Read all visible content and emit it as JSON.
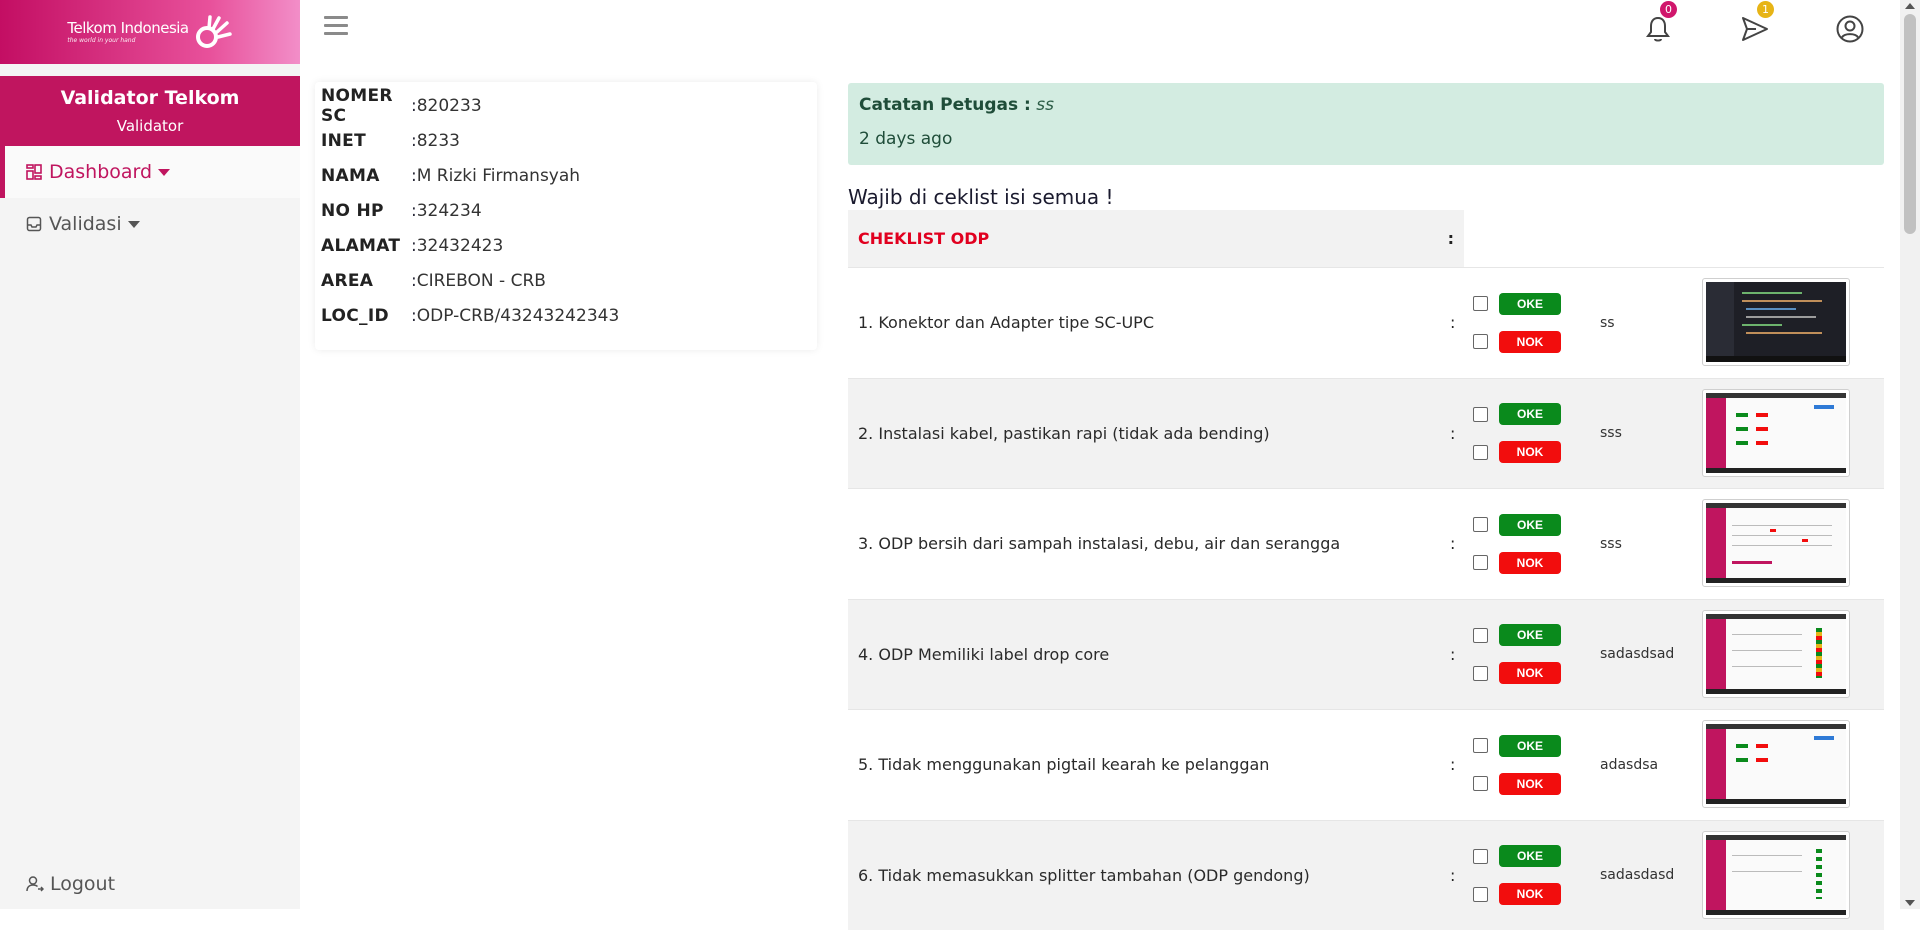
{
  "brand": {
    "name": "Telkom Indonesia",
    "tagline": "the world in your hand",
    "color": "#c0155f"
  },
  "sidebar": {
    "user_name": "Validator Telkom",
    "user_role": "Validator",
    "items": [
      {
        "label": "Dashboard",
        "icon": "dashboard-icon"
      },
      {
        "label": "Validasi",
        "icon": "inbox-icon"
      }
    ],
    "logout": "Logout"
  },
  "topbar": {
    "notif_count": "0",
    "message_count": "1"
  },
  "info": {
    "rows": [
      {
        "label": "NOMER SC",
        "sep": ":",
        "value": "820233"
      },
      {
        "label": "INET",
        "sep": ":",
        "value": "8233"
      },
      {
        "label": "NAMA",
        "sep": ":",
        "value": "M Rizki Firmansyah"
      },
      {
        "label": "NO HP",
        "sep": ":",
        "value": "324234"
      },
      {
        "label": "ALAMAT",
        "sep": ":",
        "value": "32432423"
      },
      {
        "label": "AREA",
        "sep": ":",
        "value": "CIREBON - CRB"
      },
      {
        "label": "LOC_ID",
        "sep": ":",
        "value": "ODP-CRB/43243242343"
      }
    ]
  },
  "note": {
    "label": "Catatan Petugas :",
    "text": "ss",
    "time": "2 days ago"
  },
  "warning": "Wajib di ceklist isi semua !",
  "checklist": {
    "title": "CHEKLIST ODP",
    "colon": ":",
    "ok_label": "OKE",
    "nok_label": "NOK",
    "items": [
      {
        "label": "1. Konektor dan Adapter tipe SC-UPC",
        "note": "ss"
      },
      {
        "label": "2. Instalasi kabel, pastikan rapi (tidak ada bending)",
        "note": "sss"
      },
      {
        "label": "3. ODP bersih dari sampah instalasi, debu, air dan serangga",
        "note": "sss"
      },
      {
        "label": "4. ODP Memiliki label drop core",
        "note": "sadasdsad"
      },
      {
        "label": "5. Tidak menggunakan pigtail kearah ke pelanggan",
        "note": "adasdsa"
      },
      {
        "label": "6. Tidak memasukkan splitter tambahan (ODP gendong)",
        "note": "sadasdasd"
      }
    ]
  }
}
